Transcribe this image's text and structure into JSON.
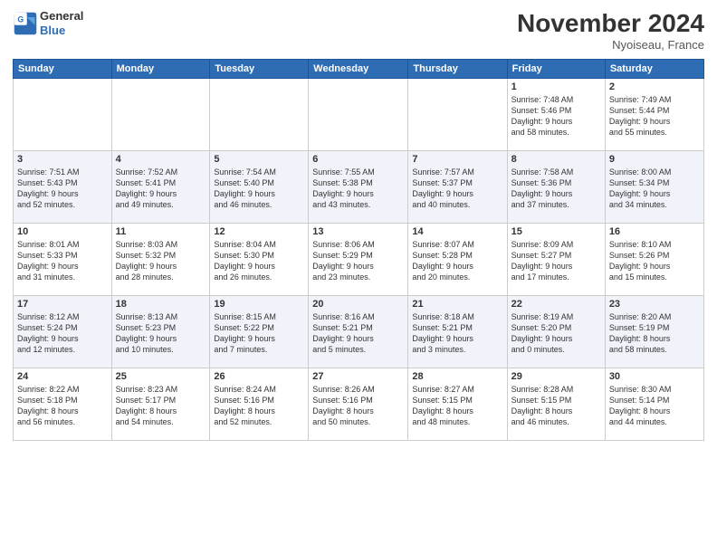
{
  "logo": {
    "line1": "General",
    "line2": "Blue"
  },
  "header": {
    "month": "November 2024",
    "location": "Nyoiseau, France"
  },
  "weekdays": [
    "Sunday",
    "Monday",
    "Tuesday",
    "Wednesday",
    "Thursday",
    "Friday",
    "Saturday"
  ],
  "weeks": [
    [
      {
        "day": "",
        "info": ""
      },
      {
        "day": "",
        "info": ""
      },
      {
        "day": "",
        "info": ""
      },
      {
        "day": "",
        "info": ""
      },
      {
        "day": "",
        "info": ""
      },
      {
        "day": "1",
        "info": "Sunrise: 7:48 AM\nSunset: 5:46 PM\nDaylight: 9 hours\nand 58 minutes."
      },
      {
        "day": "2",
        "info": "Sunrise: 7:49 AM\nSunset: 5:44 PM\nDaylight: 9 hours\nand 55 minutes."
      }
    ],
    [
      {
        "day": "3",
        "info": "Sunrise: 7:51 AM\nSunset: 5:43 PM\nDaylight: 9 hours\nand 52 minutes."
      },
      {
        "day": "4",
        "info": "Sunrise: 7:52 AM\nSunset: 5:41 PM\nDaylight: 9 hours\nand 49 minutes."
      },
      {
        "day": "5",
        "info": "Sunrise: 7:54 AM\nSunset: 5:40 PM\nDaylight: 9 hours\nand 46 minutes."
      },
      {
        "day": "6",
        "info": "Sunrise: 7:55 AM\nSunset: 5:38 PM\nDaylight: 9 hours\nand 43 minutes."
      },
      {
        "day": "7",
        "info": "Sunrise: 7:57 AM\nSunset: 5:37 PM\nDaylight: 9 hours\nand 40 minutes."
      },
      {
        "day": "8",
        "info": "Sunrise: 7:58 AM\nSunset: 5:36 PM\nDaylight: 9 hours\nand 37 minutes."
      },
      {
        "day": "9",
        "info": "Sunrise: 8:00 AM\nSunset: 5:34 PM\nDaylight: 9 hours\nand 34 minutes."
      }
    ],
    [
      {
        "day": "10",
        "info": "Sunrise: 8:01 AM\nSunset: 5:33 PM\nDaylight: 9 hours\nand 31 minutes."
      },
      {
        "day": "11",
        "info": "Sunrise: 8:03 AM\nSunset: 5:32 PM\nDaylight: 9 hours\nand 28 minutes."
      },
      {
        "day": "12",
        "info": "Sunrise: 8:04 AM\nSunset: 5:30 PM\nDaylight: 9 hours\nand 26 minutes."
      },
      {
        "day": "13",
        "info": "Sunrise: 8:06 AM\nSunset: 5:29 PM\nDaylight: 9 hours\nand 23 minutes."
      },
      {
        "day": "14",
        "info": "Sunrise: 8:07 AM\nSunset: 5:28 PM\nDaylight: 9 hours\nand 20 minutes."
      },
      {
        "day": "15",
        "info": "Sunrise: 8:09 AM\nSunset: 5:27 PM\nDaylight: 9 hours\nand 17 minutes."
      },
      {
        "day": "16",
        "info": "Sunrise: 8:10 AM\nSunset: 5:26 PM\nDaylight: 9 hours\nand 15 minutes."
      }
    ],
    [
      {
        "day": "17",
        "info": "Sunrise: 8:12 AM\nSunset: 5:24 PM\nDaylight: 9 hours\nand 12 minutes."
      },
      {
        "day": "18",
        "info": "Sunrise: 8:13 AM\nSunset: 5:23 PM\nDaylight: 9 hours\nand 10 minutes."
      },
      {
        "day": "19",
        "info": "Sunrise: 8:15 AM\nSunset: 5:22 PM\nDaylight: 9 hours\nand 7 minutes."
      },
      {
        "day": "20",
        "info": "Sunrise: 8:16 AM\nSunset: 5:21 PM\nDaylight: 9 hours\nand 5 minutes."
      },
      {
        "day": "21",
        "info": "Sunrise: 8:18 AM\nSunset: 5:21 PM\nDaylight: 9 hours\nand 3 minutes."
      },
      {
        "day": "22",
        "info": "Sunrise: 8:19 AM\nSunset: 5:20 PM\nDaylight: 9 hours\nand 0 minutes."
      },
      {
        "day": "23",
        "info": "Sunrise: 8:20 AM\nSunset: 5:19 PM\nDaylight: 8 hours\nand 58 minutes."
      }
    ],
    [
      {
        "day": "24",
        "info": "Sunrise: 8:22 AM\nSunset: 5:18 PM\nDaylight: 8 hours\nand 56 minutes."
      },
      {
        "day": "25",
        "info": "Sunrise: 8:23 AM\nSunset: 5:17 PM\nDaylight: 8 hours\nand 54 minutes."
      },
      {
        "day": "26",
        "info": "Sunrise: 8:24 AM\nSunset: 5:16 PM\nDaylight: 8 hours\nand 52 minutes."
      },
      {
        "day": "27",
        "info": "Sunrise: 8:26 AM\nSunset: 5:16 PM\nDaylight: 8 hours\nand 50 minutes."
      },
      {
        "day": "28",
        "info": "Sunrise: 8:27 AM\nSunset: 5:15 PM\nDaylight: 8 hours\nand 48 minutes."
      },
      {
        "day": "29",
        "info": "Sunrise: 8:28 AM\nSunset: 5:15 PM\nDaylight: 8 hours\nand 46 minutes."
      },
      {
        "day": "30",
        "info": "Sunrise: 8:30 AM\nSunset: 5:14 PM\nDaylight: 8 hours\nand 44 minutes."
      }
    ]
  ]
}
